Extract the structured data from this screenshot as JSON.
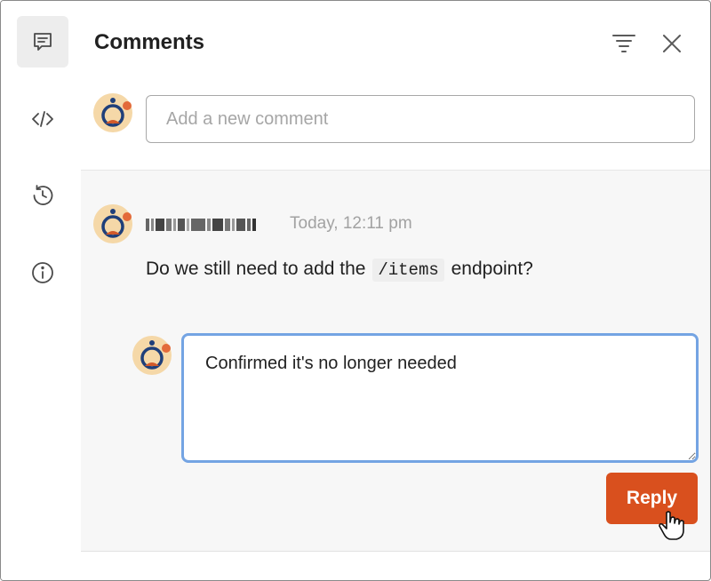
{
  "panel": {
    "title": "Comments"
  },
  "sidebar": {
    "items": [
      {
        "icon": "comment-icon",
        "active": true
      },
      {
        "icon": "code-icon",
        "active": false
      },
      {
        "icon": "history-icon",
        "active": false
      },
      {
        "icon": "info-icon",
        "active": false
      }
    ]
  },
  "header_icons": [
    "filter-icon",
    "close-icon"
  ],
  "new_comment": {
    "placeholder": "Add a new comment"
  },
  "thread": {
    "author": "redacted",
    "timestamp": "Today, 12:11 pm",
    "message_before": "Do we still need to add the",
    "message_code": "/items",
    "message_after": "endpoint?",
    "reply_value": "Confirmed it's no longer needed",
    "reply_button": "Reply"
  },
  "colors": {
    "accent": "#d9501e",
    "focus_border": "#74a4e3",
    "thread_bg": "#f7f7f7"
  }
}
